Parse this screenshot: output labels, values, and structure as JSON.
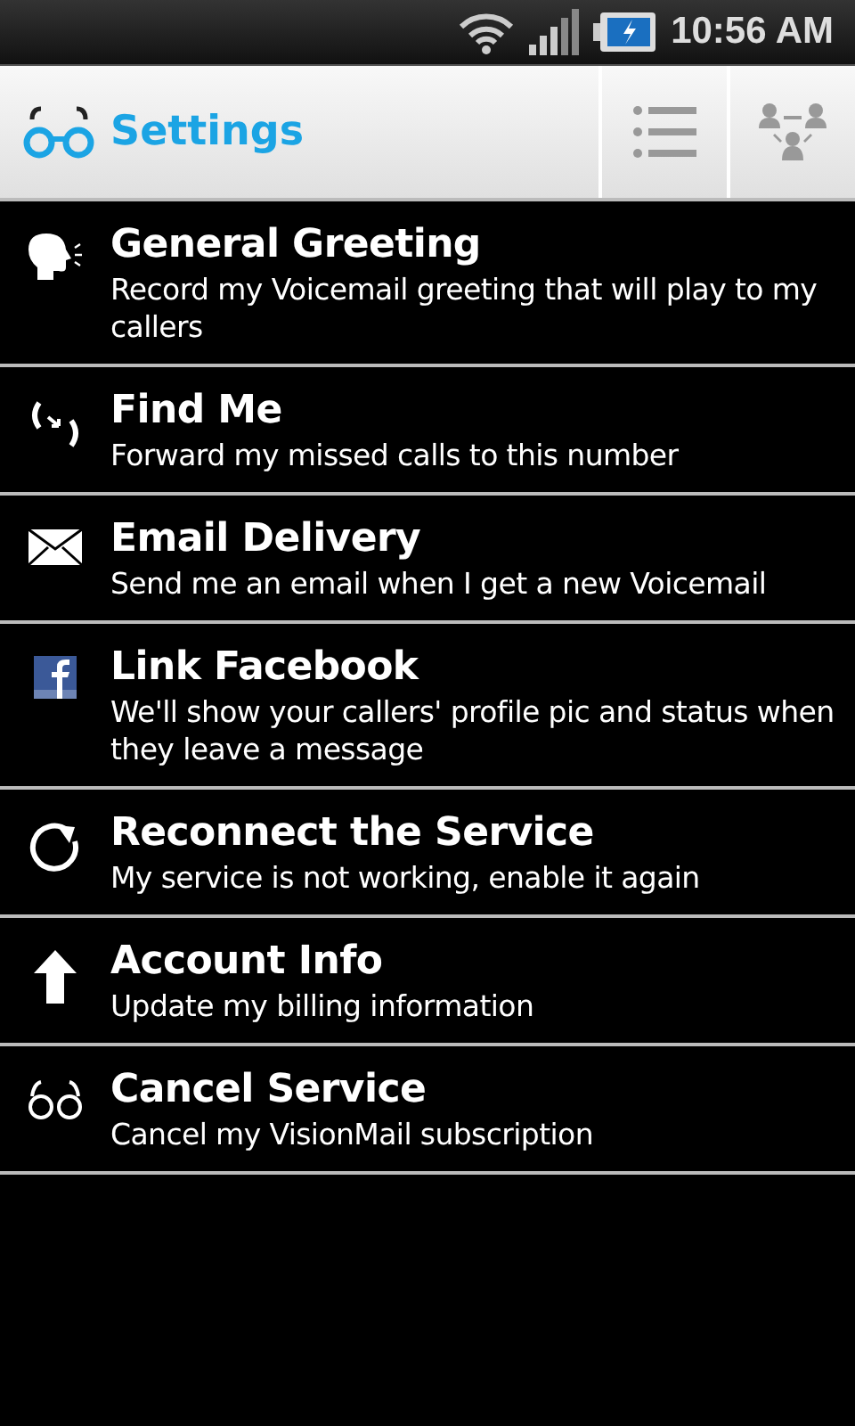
{
  "status_bar": {
    "time": "10:56 AM"
  },
  "header": {
    "title": "Settings"
  },
  "items": [
    {
      "kind": "greeting",
      "title": "General Greeting",
      "description": "Record my Voicemail greeting that will play to my callers"
    },
    {
      "kind": "findme",
      "title": "Find Me",
      "description": "Forward my missed calls to this number"
    },
    {
      "kind": "email",
      "title": "Email Delivery",
      "description": "Send me an email when I get a new Voicemail"
    },
    {
      "kind": "facebook",
      "title": "Link Facebook",
      "description": "We'll show your callers' profile pic and status when they leave a message"
    },
    {
      "kind": "reconnect",
      "title": "Reconnect the Service",
      "description": "My service is not working, enable it again"
    },
    {
      "kind": "account",
      "title": "Account Info",
      "description": "Update my billing information"
    },
    {
      "kind": "cancel",
      "title": "Cancel Service",
      "description": "Cancel my VisionMail subscription"
    }
  ]
}
